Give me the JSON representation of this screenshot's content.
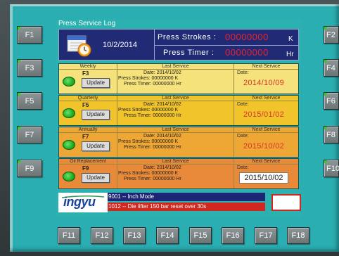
{
  "screen": {
    "title": "Press Service Log",
    "date": "10/2/2014",
    "press_strokes_label": "Press  Strokes :",
    "press_strokes_value": "00000000",
    "press_strokes_unit": "K",
    "press_timer_label": "Press  Timer :",
    "press_timer_value": "00000000",
    "press_timer_unit": "Hr"
  },
  "columns": {
    "last": "Last Service",
    "next": "Next Service"
  },
  "services": [
    {
      "name": "Weekly",
      "key": "F3",
      "button": "Update",
      "date_line": "Date: 2014/10/02",
      "strokes_line": "Press Strokes: 00000000  K",
      "timer_line": "Press Timer: 00000000  Hr",
      "next_label": "Date:",
      "next_date": "2014/10/09",
      "color": "#f6e27a"
    },
    {
      "name": "Quarterly",
      "key": "F5",
      "button": "Update",
      "date_line": "Date: 2014/10/02",
      "strokes_line": "Press Strokes: 00000000  K",
      "timer_line": "Press Timer: 00000000  Hr",
      "next_label": "Date:",
      "next_date": "2015/01/02",
      "color": "#f1c42c"
    },
    {
      "name": "Annually",
      "key": "F7",
      "button": "Update",
      "date_line": "Date: 2014/10/02",
      "strokes_line": "Press Strokes: 00000000  K",
      "timer_line": "Press Timer: 00000000  Hr",
      "next_label": "Date:",
      "next_date": "2015/10/02",
      "color": "#eea634"
    },
    {
      "name": "Oil Replacement",
      "key": "F9",
      "button": "Update",
      "date_line": "Date: 2014/10/02",
      "strokes_line": "Press Strokes: 00000000  K",
      "timer_line": "Press Timer: 00000000  Hr",
      "next_label": "Date:",
      "next_date": "2015/10/02",
      "color": "#e88a3a"
    }
  ],
  "footer": {
    "brand": "ingyu",
    "message_1": "9001 -- Inch Mode",
    "message_2": "1012 -- Die lifter 150 bar reset over 30s"
  },
  "left_keys": [
    "F1",
    "F3",
    "F5",
    "F7",
    "F9"
  ],
  "right_keys": [
    "F2",
    "F4",
    "F6",
    "F8",
    "F10"
  ],
  "bottom_keys": [
    "F11",
    "F12",
    "F13",
    "F14",
    "F15",
    "F16",
    "F17",
    "F18"
  ],
  "colors": {
    "panel": "#2aaeb1",
    "header": "#202a75",
    "accent_red": "#e8232f"
  }
}
